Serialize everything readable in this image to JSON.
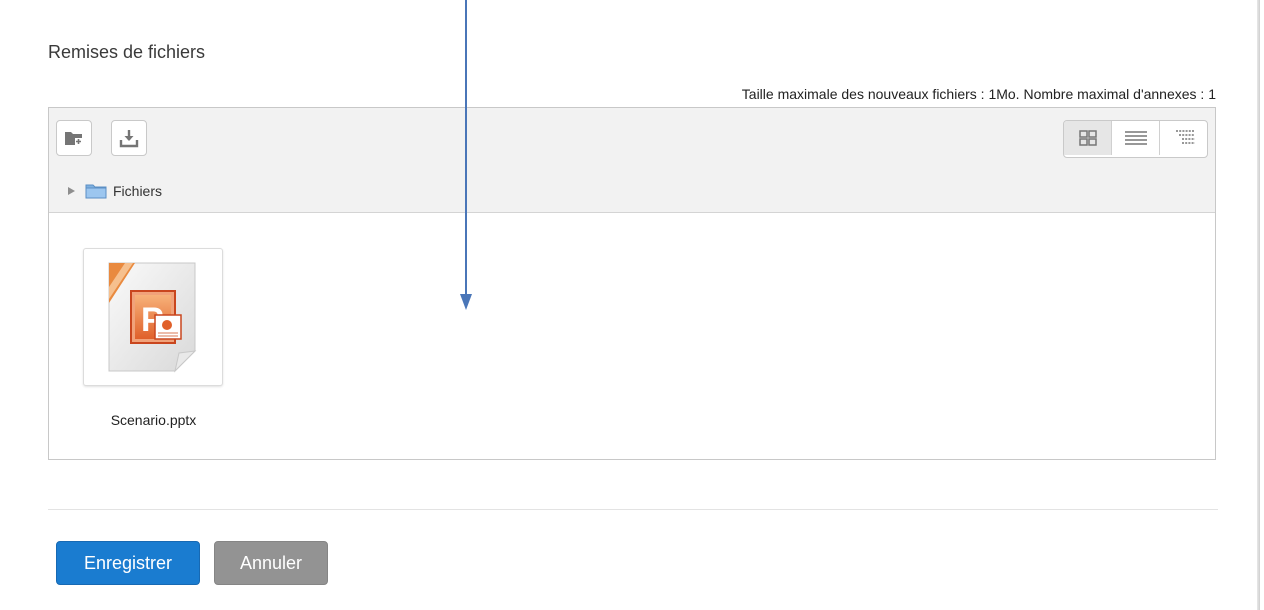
{
  "section": {
    "title": "Remises de fichiers"
  },
  "limits": {
    "text": "Taille maximale des nouveaux fichiers : 1Mo. Nombre maximal d'annexes : 1"
  },
  "toolbar": {
    "buttons": [
      {
        "icon": "folder-add-icon"
      },
      {
        "icon": "download-icon"
      }
    ],
    "views": [
      {
        "icon": "icon-view-icon",
        "active": true
      },
      {
        "icon": "list-view-icon",
        "active": false
      },
      {
        "icon": "tree-view-icon",
        "active": false
      }
    ]
  },
  "path": {
    "folder_label": "Fichiers"
  },
  "files": [
    {
      "name": "Scenario.pptx",
      "icon": "powerpoint-file-icon"
    }
  ],
  "actions": {
    "save_label": "Enregistrer",
    "cancel_label": "Annuler"
  },
  "colors": {
    "primary": "#1a7cd0",
    "secondary": "#939393",
    "annotation_arrow": "#4a76b8"
  }
}
